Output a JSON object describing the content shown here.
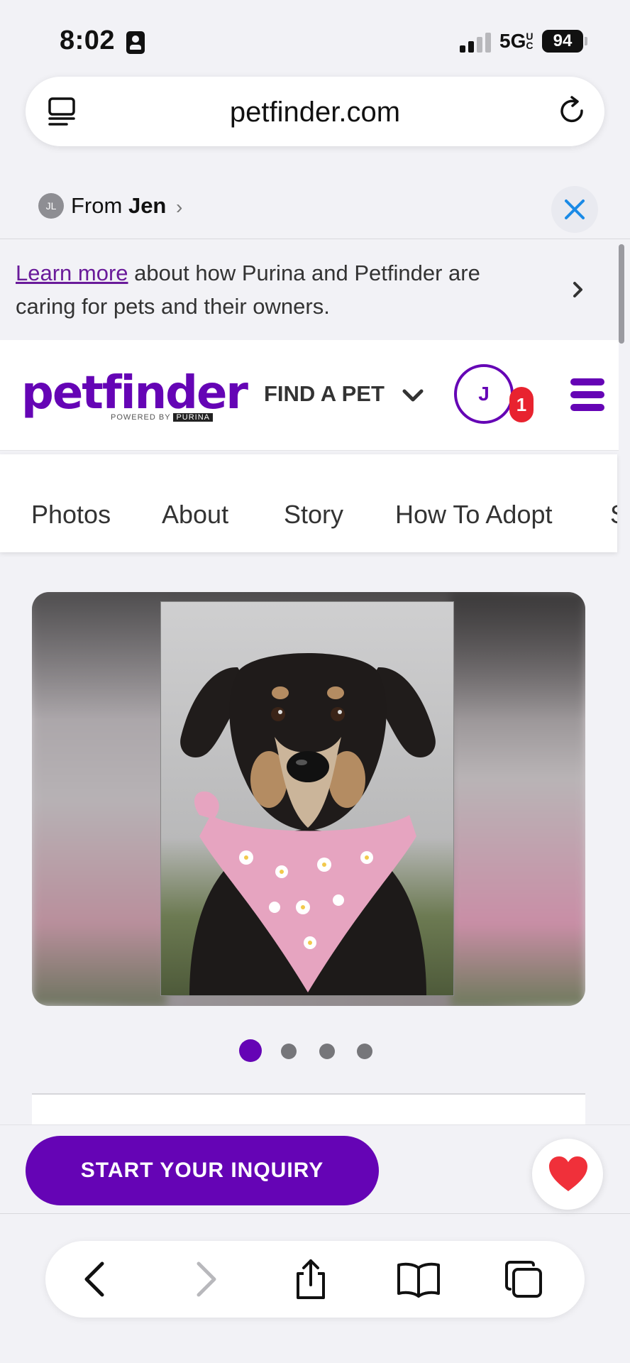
{
  "status_bar": {
    "time": "8:02",
    "network": "5G",
    "network_sub": "UC",
    "battery": "94"
  },
  "browser": {
    "url": "petfinder.com",
    "shared_from_prefix": "From",
    "shared_from_name": "Jen",
    "shared_from_initials": "JL"
  },
  "banner": {
    "link_text": "Learn more",
    "text": " about how Purina and Petfinder are caring for pets and their owners."
  },
  "header": {
    "logo_text": "petfinder",
    "logo_powered_by": "POWERED BY",
    "logo_brand": "PURINA",
    "find_a_pet": "FIND A PET",
    "avatar_initial": "J",
    "notification_count": "1"
  },
  "tabs": [
    {
      "label": "Photos"
    },
    {
      "label": "About"
    },
    {
      "label": "Story"
    },
    {
      "label": "How To Adopt"
    },
    {
      "label": "S"
    }
  ],
  "carousel": {
    "total": 4,
    "active_index": 0
  },
  "actions": {
    "inquiry_label": "START YOUR INQUIRY"
  },
  "colors": {
    "brand_purple": "#6504b5",
    "badge_red": "#e8232f",
    "favorite_red": "#f0303a",
    "close_blue": "#1a8ae6"
  },
  "icons": {
    "tab_overview": "tab-overview-icon",
    "reload": "reload-icon",
    "back": "back-chevron-icon",
    "forward": "forward-chevron-icon",
    "share": "share-icon",
    "bookmarks": "bookmarks-icon",
    "tabs": "tabs-icon",
    "favorite": "heart-icon"
  }
}
